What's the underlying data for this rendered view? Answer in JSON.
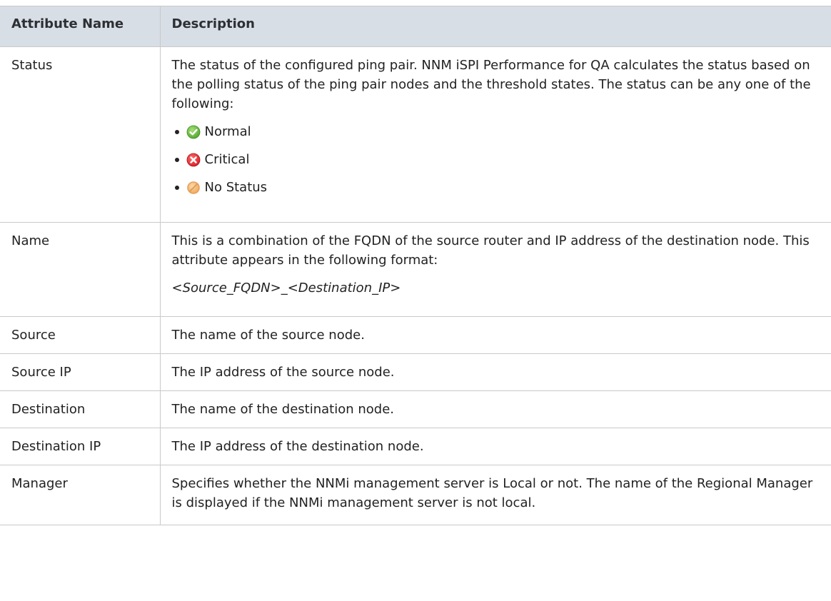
{
  "table": {
    "headers": {
      "attribute_name": "Attribute Name",
      "description": "Description"
    },
    "status_row": {
      "name": "Status",
      "description": "The status of the configured ping pair. NNM iSPI Performance for QA calculates the status based on the polling status of the ping pair nodes and the threshold states. The status can be any one of the following:",
      "statuses": [
        {
          "label": "Normal",
          "icon": "normal-status-icon",
          "color": "#5cb531"
        },
        {
          "label": "Critical",
          "icon": "critical-status-icon",
          "color": "#e0262f"
        },
        {
          "label": "No Status",
          "icon": "no-status-icon",
          "color": "#f2b36b"
        }
      ]
    },
    "name_row": {
      "name": "Name",
      "description": "This is a combination of the FQDN of the source router and IP address of the destination node. This attribute appears in the following format:",
      "format": "<Source_FQDN>_<Destination_IP>"
    },
    "rows": [
      {
        "name": "Source",
        "description": "The name of the source node."
      },
      {
        "name": "Source IP",
        "description": "The IP address of the source node."
      },
      {
        "name": "Destination",
        "description": "The name of the destination node."
      },
      {
        "name": "Destination IP",
        "description": "The IP address of the destination node."
      }
    ],
    "manager_row": {
      "name": "Manager",
      "description": "Specifies whether the NNMi management server is Local or not. The name of the Regional Manager is displayed if the NNMi management server is not local."
    }
  }
}
